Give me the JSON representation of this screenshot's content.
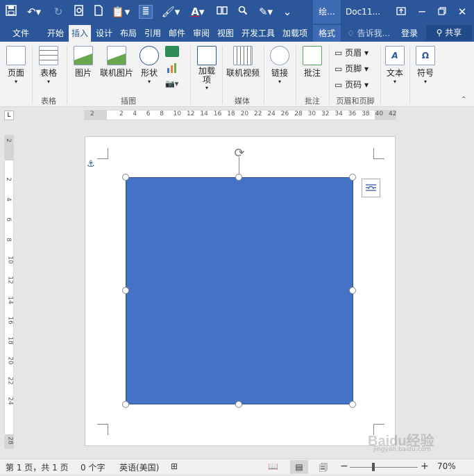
{
  "titlebar": {
    "context_tab": "绘...",
    "doc_title": "Doc11..."
  },
  "tabs": [
    "文件",
    "开始",
    "插入",
    "设计",
    "布局",
    "引用",
    "邮件",
    "审阅",
    "视图",
    "开发工具",
    "加载项",
    "格式"
  ],
  "tell_me": "告诉我...",
  "login": "登录",
  "share": "共享",
  "ribbon": {
    "page": "页面",
    "table": "表格",
    "picture": "图片",
    "online_picture": "联机图片",
    "shapes": "形状",
    "addins": "加载\n项",
    "online_video": "联机视频",
    "link": "链接",
    "comment": "批注",
    "header": "页眉",
    "footer": "页脚",
    "page_number": "页码",
    "text": "文本",
    "symbol": "符号",
    "groups": {
      "table": "表格",
      "illustrations": "插图",
      "media": "媒体",
      "comments": "批注",
      "header_footer": "页眉和页脚"
    }
  },
  "hruler_ticks": [
    "2",
    "2",
    "4",
    "6",
    "8",
    "10",
    "12",
    "14",
    "16",
    "18",
    "20",
    "22",
    "24",
    "26",
    "28",
    "30",
    "32",
    "34",
    "36",
    "38",
    "40",
    "42"
  ],
  "vruler_ticks": [
    "2",
    "2",
    "4",
    "6",
    "8",
    "10",
    "12",
    "14",
    "16",
    "18",
    "20",
    "22",
    "24",
    "28"
  ],
  "status": {
    "page": "第 1 页，共 1 页",
    "words": "0 个字",
    "language": "英语(美国)",
    "zoom": "70%"
  },
  "watermark": "Baidu经验",
  "watermark_url": "jingyan.baidu.com",
  "colors": {
    "ribbon_blue": "#2b579a",
    "shape_fill": "#4472c4"
  }
}
